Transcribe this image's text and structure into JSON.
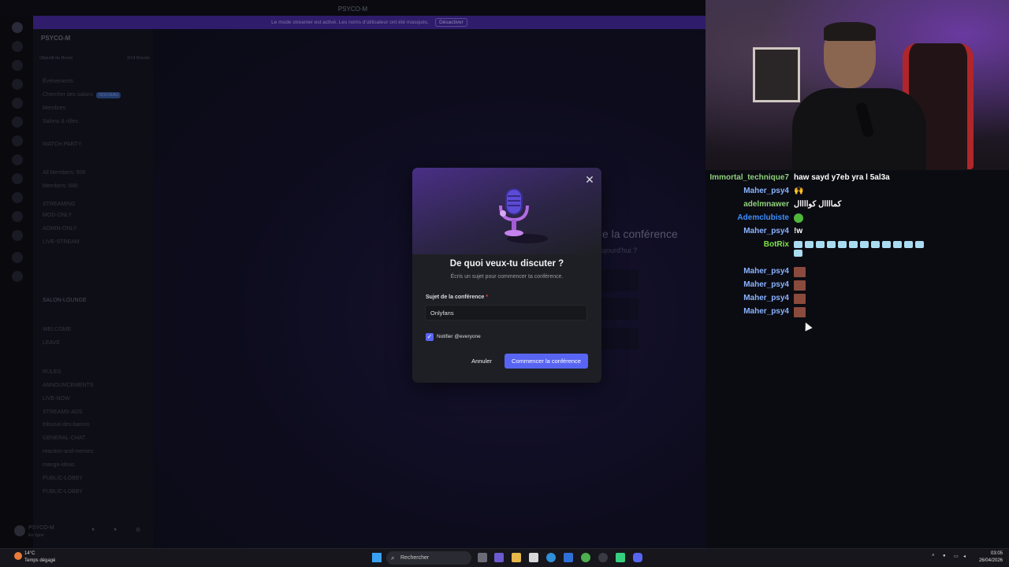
{
  "discord": {
    "window_title": "PSYCO-M",
    "banner_text": "Le mode streamer est activé. Les noms d'utilisateur ont été masqués.",
    "banner_button": "Désactiver",
    "server_name": "PSYCO-M",
    "boost_label": "Objectif du Boost",
    "boost_count": "2/14 Boosts",
    "channels": [
      {
        "label": "Événements"
      },
      {
        "label": "Chercher des salons",
        "badge": "NOUVEAU"
      },
      {
        "label": "Membres"
      },
      {
        "label": "Salons & rôles"
      },
      {
        "label": "WATCH PARTY"
      },
      {
        "label": "All Members: 506"
      },
      {
        "label": "Members: 880"
      },
      {
        "label": "STREAMING"
      },
      {
        "label": "MOD-ONLY"
      },
      {
        "label": "ADMIN-ONLY"
      },
      {
        "label": "LIVE-STREAM"
      },
      {
        "label": "SALON-LOUNGE"
      },
      {
        "label": "WELCOME"
      },
      {
        "label": "LEAVE"
      },
      {
        "label": "RULES"
      },
      {
        "label": "ANNOUNCEMENTS"
      },
      {
        "label": "LIVE-NOW"
      },
      {
        "label": "STREAMS-ADS"
      },
      {
        "label": "tribunal-des-bannis"
      },
      {
        "label": "GENERAL-CHAT"
      },
      {
        "label": "reaction-and-memes"
      },
      {
        "label": "manga-ideas"
      },
      {
        "label": "PUBLIC-LOBBY"
      },
      {
        "label": "PUBLIC-LOBBY"
      }
    ],
    "user_name": "PSYCO-M",
    "user_status": "En ligne",
    "background_title": "e la conférence",
    "background_sub": "ujourd'hui ?"
  },
  "modal": {
    "title": "De quoi veux-tu discuter ?",
    "subtitle": "Écris un sujet pour commencer ta conférence.",
    "topic_label": "Sujet de la conférence",
    "required_mark": "*",
    "topic_value": "Onlyfans",
    "notify_label": "Notifier @everyone",
    "notify_checked": true,
    "cancel_label": "Annuler",
    "start_label": "Commencer la conférence",
    "close_symbol": "✕"
  },
  "chat": [
    {
      "user": "Immortal_technique7",
      "text": "haw sayd y7eb yra l 5al3a",
      "color": "#8fd17a"
    },
    {
      "user": "Maher_psy4",
      "text": "🙌",
      "color": "#8ab4ff"
    },
    {
      "user": "adelmnawer",
      "text": "كماااال كواااال",
      "color": "#8fd17a"
    },
    {
      "user": "Ademclubiste",
      "text": "",
      "color": "#3d8fff",
      "emote": "green"
    },
    {
      "user": "Maher_psy4",
      "text": "!w",
      "color": "#8ab4ff"
    },
    {
      "user": "BotRix",
      "text": "",
      "color": "#7ee34a",
      "emote": "ice"
    },
    {
      "user": "Maher_psy4",
      "text": "",
      "color": "#8ab4ff",
      "emote": "face"
    },
    {
      "user": "Maher_psy4",
      "text": "",
      "color": "#8ab4ff",
      "emote": "face"
    },
    {
      "user": "Maher_psy4",
      "text": "",
      "color": "#8ab4ff",
      "emote": "face"
    },
    {
      "user": "Maher_psy4",
      "text": "",
      "color": "#8ab4ff",
      "emote": "face"
    }
  ],
  "taskbar": {
    "temperature": "14°C",
    "weather": "Temps dégagé",
    "search_placeholder": "Rechercher",
    "time": "03:05",
    "date": "26/04/2026"
  }
}
